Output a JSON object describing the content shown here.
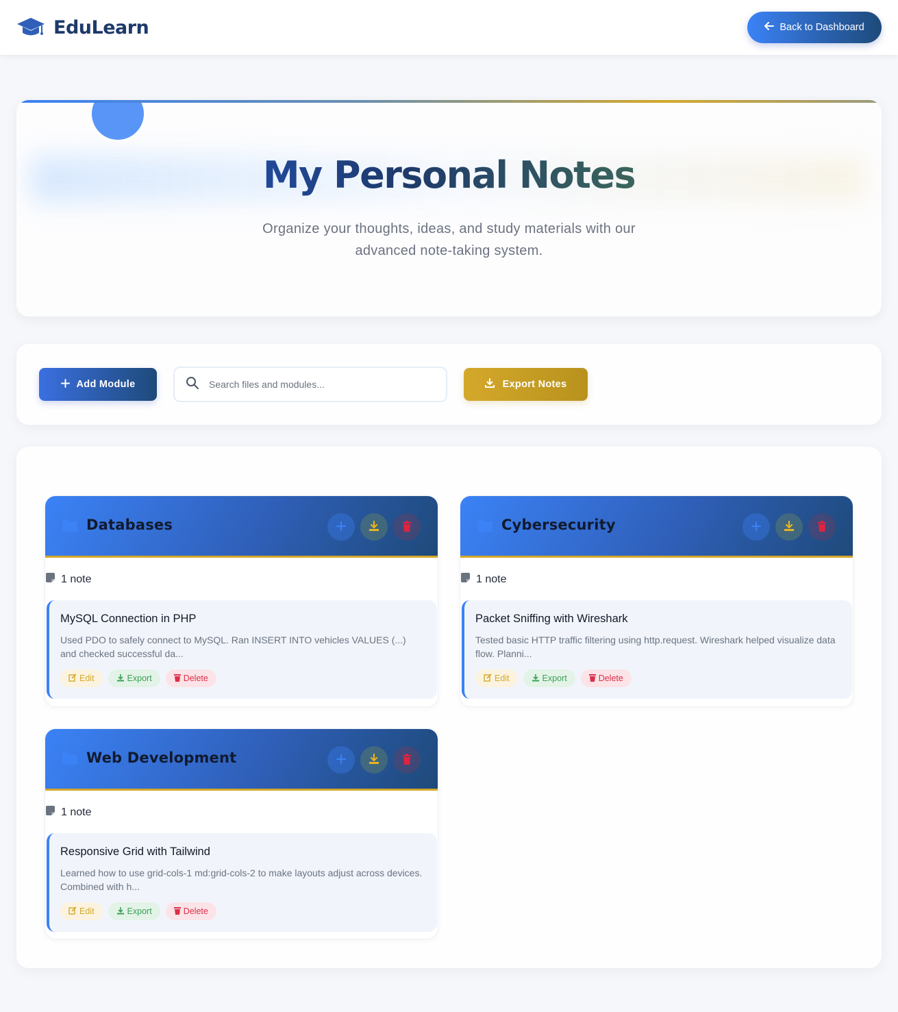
{
  "header": {
    "brand_name": "EduLearn",
    "back_button_label": "Back to Dashboard"
  },
  "hero": {
    "title": "My Personal Notes",
    "subtitle": "Organize your thoughts, ideas, and study materials with our advanced note-taking system."
  },
  "toolbar": {
    "add_module_label": "Add Module",
    "search_placeholder": "Search files and modules...",
    "export_notes_label": "Export Notes"
  },
  "modules": [
    {
      "title": "Databases",
      "note_count": "1 note",
      "note": {
        "title": "MySQL Connection in PHP",
        "body": "Used PDO to safely connect to MySQL. Ran INSERT INTO vehicles VALUES (...) and checked successful da...",
        "edit_label": "Edit",
        "export_label": "Export",
        "delete_label": "Delete"
      }
    },
    {
      "title": "Cybersecurity",
      "note_count": "1 note",
      "note": {
        "title": "Packet Sniffing with Wireshark",
        "body": "Tested basic HTTP traffic filtering using http.request. Wireshark helped visualize data flow. Planni...",
        "edit_label": "Edit",
        "export_label": "Export",
        "delete_label": "Delete"
      }
    },
    {
      "title": "Web Development",
      "note_count": "1 note",
      "note": {
        "title": "Responsive Grid with Tailwind",
        "body": "Learned how to use grid-cols-1 md:grid-cols-2 to make layouts adjust across devices. Combined with h...",
        "edit_label": "Edit",
        "export_label": "Export",
        "delete_label": "Delete"
      }
    }
  ],
  "colors": {
    "primary": "#3b82f6",
    "primary_dark": "#1e4a7a",
    "accent_gold": "#d4a82a",
    "success": "#3aa156",
    "danger": "#dc2f4a"
  },
  "icons": {
    "brand": "graduation-cap-icon",
    "back": "arrow-left-icon",
    "add": "plus-icon",
    "search": "search-icon",
    "export": "download-icon",
    "folder": "folder-icon",
    "note": "sticky-note-icon",
    "edit": "edit-icon",
    "delete": "trash-icon"
  }
}
